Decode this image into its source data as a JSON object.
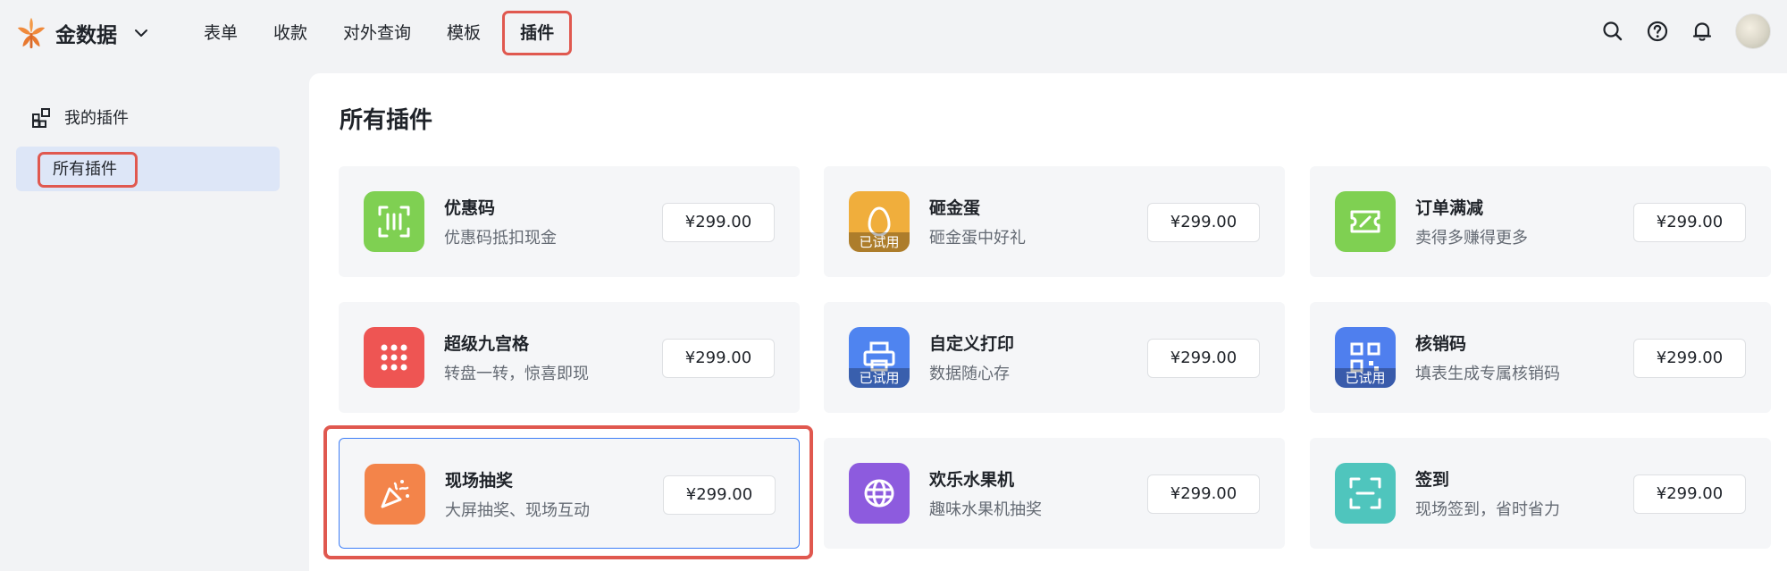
{
  "brand": {
    "name": "金数据",
    "logo_icon": "leaf-logo-icon"
  },
  "nav": {
    "items": [
      {
        "label": "表单"
      },
      {
        "label": "收款"
      },
      {
        "label": "对外查询"
      },
      {
        "label": "模板"
      },
      {
        "label": "插件",
        "active": true
      }
    ]
  },
  "header_icons": [
    "search-icon",
    "help-icon",
    "bell-icon",
    "avatar"
  ],
  "sidebar": {
    "group_label": "我的插件",
    "item_label": "所有插件"
  },
  "main": {
    "title": "所有插件",
    "plugins": [
      {
        "name": "优惠码",
        "desc": "优惠码抵扣现金",
        "price": "¥299.00",
        "color": "#7fd052",
        "icon": "scan-code-icon",
        "tried": ""
      },
      {
        "name": "砸金蛋",
        "desc": "砸金蛋中好礼",
        "price": "¥299.00",
        "color": "#f0ae3c",
        "icon": "egg-icon",
        "tried": "已试用"
      },
      {
        "name": "订单满减",
        "desc": "卖得多赚得更多",
        "price": "¥299.00",
        "color": "#7fd052",
        "icon": "ticket-icon",
        "tried": ""
      },
      {
        "name": "超级九宫格",
        "desc": "转盘一转，惊喜即现",
        "price": "¥299.00",
        "color": "#ee5553",
        "icon": "grid-dots-icon",
        "tried": ""
      },
      {
        "name": "自定义打印",
        "desc": "数据随心存",
        "price": "¥299.00",
        "color": "#4f84f0",
        "icon": "printer-icon",
        "tried": "已试用"
      },
      {
        "name": "核销码",
        "desc": "填表生成专属核销码",
        "price": "¥299.00",
        "color": "#4f7fee",
        "icon": "qr-code-icon",
        "tried": "已试用"
      },
      {
        "name": "现场抽奖",
        "desc": "大屏抽奖、现场互动",
        "price": "¥299.00",
        "color": "#f3844a",
        "icon": "party-popper-icon",
        "tried": ""
      },
      {
        "name": "欢乐水果机",
        "desc": "趣味水果机抽奖",
        "price": "¥299.00",
        "color": "#8d5bde",
        "icon": "slot-machine-icon",
        "tried": ""
      },
      {
        "name": "签到",
        "desc": "现场签到，省时省力",
        "price": "¥299.00",
        "color": "#4fc5bd",
        "icon": "scan-frame-icon",
        "tried": ""
      }
    ]
  },
  "colors": {
    "accent": "#3d7ef7",
    "highlight_border": "#e0584f",
    "sidebar_active_bg": "#dde6f7"
  }
}
